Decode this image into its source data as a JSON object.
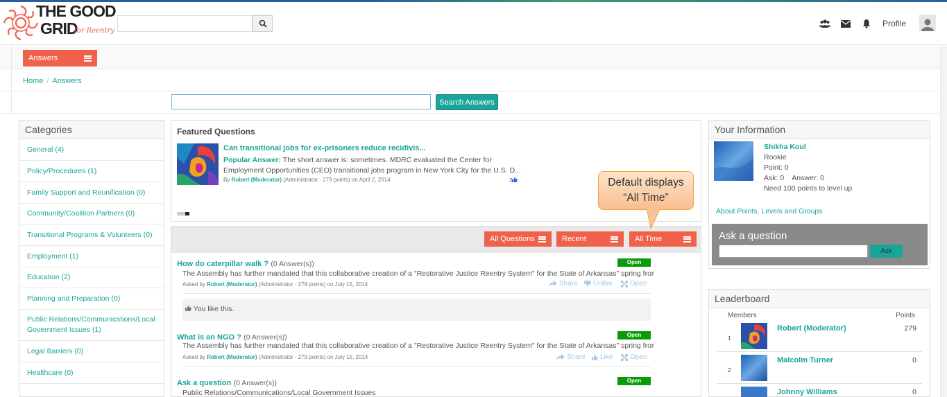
{
  "brand": {
    "logo_text_line1": "THE GOOD",
    "logo_text_line2": "GRID",
    "logo_tagline": "for Reentry",
    "accent": "#f0614b",
    "link": "#1aa59a"
  },
  "header": {
    "search_placeholder": "",
    "search_icon": "search-icon",
    "icons": [
      "users-icon",
      "envelope-icon",
      "bell-icon"
    ],
    "profile_label": "Profile"
  },
  "section_menu": {
    "label": "Answers"
  },
  "breadcrumb": {
    "home": "Home",
    "sep": "/",
    "current": "Answers"
  },
  "answer_search": {
    "placeholder": "",
    "button": "Search Answers"
  },
  "categories": {
    "title": "Categories",
    "items": [
      "General (4)",
      "Policy/Procedures (1)",
      "Family Support and Reunification (0)",
      "Community/Coalition Partners (0)",
      "Transitional Programs & Volunteers (0)",
      "Employment (1)",
      "Education (2)",
      "Planning and Preparation (0)",
      "Public Relations/Communications/Local Government Issues (1)",
      "Legal Barriers (0)",
      "Healthcare (0)"
    ]
  },
  "featured": {
    "title": "Featured Questions",
    "question": "Can transitional jobs for ex-prisoners reduce recidivis...",
    "answer_label": "Popular Answer:",
    "answer_text": "The short answer is: sometimes. MDRC evaluated the Center for Employment Opportunities (CEO) transitional jobs program in New York City for the U.S. D...",
    "by": "By",
    "author": "Robert (Moderator)",
    "author_meta": "(Administrator - 279 points)",
    "date": "on April 2, 2014",
    "likes": "2"
  },
  "filters": [
    "All Questions",
    "Recent",
    "All Time"
  ],
  "questions": [
    {
      "title": "How do caterpillar walk ?",
      "count": "(0 Answer(s))",
      "status": "Open",
      "desc": "The Assembly has further mandated that this collaborative creation of a \"Restorative Justice Reentry System\" for the State of Arkansas\" spring from op...",
      "asked_by": "Asked by",
      "author": "Robert (Moderator)",
      "meta": "(Administrator - 279 points) on July 15, 2014",
      "share": "Share",
      "like": "Unlike",
      "open": "Open",
      "liked_note": "You like this."
    },
    {
      "title": "What is an NGO ?",
      "count": "(0 Answer(s))",
      "status": "Open",
      "desc": "The Assembly has further mandated that this collaborative creation of a \"Restorative Justice Reentry System\" for the State of Arkansas\" spring from op...",
      "asked_by": "Asked by",
      "author": "Robert (Moderator)",
      "meta": "(Administrator - 279 points) on July 15, 2014",
      "share": "Share",
      "like": "Like",
      "open": "Open"
    },
    {
      "title": "Ask a question",
      "count": "(0 Answer(s))",
      "status": "Open",
      "desc": "Public Relations/Communications/Local Government Issues"
    }
  ],
  "callout": {
    "line1": "Default displays",
    "line2": "“All Time”"
  },
  "your_info": {
    "title": "Your Information",
    "name": "Shikha Koul",
    "level": "Rookie",
    "points": "Point: 0",
    "ask_answer": "Ask: 0    Answer: 0",
    "need": "Need 100 points to level up",
    "about_link": "About Points, Levels and Groups"
  },
  "ask_box": {
    "title": "Ask a question",
    "placeholder": "",
    "button": "Ask"
  },
  "leaderboard": {
    "title": "Leaderboard",
    "col_members": "Members",
    "col_points": "Points",
    "rows": [
      {
        "rank": "1",
        "name": "Robert (Moderator)",
        "points": "279"
      },
      {
        "rank": "2",
        "name": "Malcolm Turner",
        "points": "0"
      },
      {
        "rank": "3",
        "name": "Johnny Williams",
        "points": "0"
      }
    ]
  }
}
